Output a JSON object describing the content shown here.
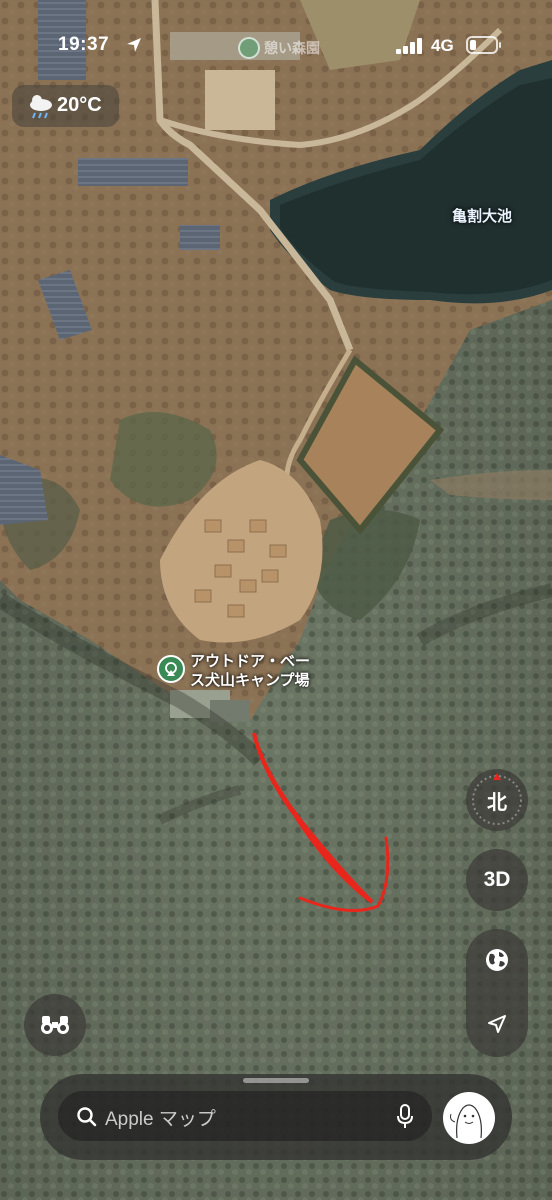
{
  "status_bar": {
    "time": "19:37",
    "network": "4G"
  },
  "weather": {
    "temperature": "20°C",
    "icon": "cloud-rain-icon"
  },
  "map": {
    "view": "satellite",
    "lake_label": "亀割大池",
    "poi": {
      "name": "アウトドア・ベース犬山キャンプ場",
      "line1": "アウトドア・ベー",
      "line2": "ス犬山キャンプ場",
      "icon": "campsite-icon"
    },
    "top_poi_label": "憩い森園"
  },
  "controls": {
    "compass_label": "北",
    "three_d_label": "3D",
    "globe_icon": "globe-icon",
    "locate_icon": "location-arrow-icon",
    "look_around_icon": "binoculars-icon"
  },
  "search": {
    "placeholder": "Apple マップ",
    "search_icon": "search-icon",
    "mic_icon": "microphone-icon"
  },
  "annotation": {
    "color": "#e8261c"
  }
}
